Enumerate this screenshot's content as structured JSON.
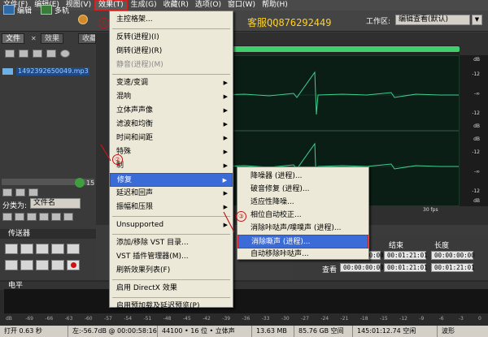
{
  "menubar": {
    "items": [
      "文件(F)",
      "编辑(E)",
      "视图(V)",
      "效果(T)",
      "生成(G)",
      "收藏(R)",
      "选项(O)",
      "窗口(W)",
      "帮助(H)"
    ],
    "active_index": 3
  },
  "toolbar": {
    "edit_label": "编辑",
    "multitrack_label": "多轨",
    "service_text": "客服QQ876292449",
    "workspace_label": "工作区:",
    "workspace_value": "编辑查看(默认)"
  },
  "left_panel": {
    "tabs": [
      "文件",
      "效果",
      "收藏"
    ],
    "selected_tab": 0,
    "file_name": "1492392650049.mp3",
    "sort_label": "分类为:",
    "sort_value": "文件名",
    "count": "15",
    "transport_label": "传送器"
  },
  "effects_menu": {
    "items": [
      {
        "label": "主控格架...",
        "disabled": false,
        "submenu": false
      },
      {
        "label": "反转(进程)(I)",
        "disabled": false,
        "submenu": false
      },
      {
        "label": "倒转(进程)(R)",
        "disabled": false,
        "submenu": false
      },
      {
        "label": "静音(进程)(M)",
        "disabled": true,
        "submenu": false
      },
      {
        "label": "变速/变调",
        "disabled": false,
        "submenu": true
      },
      {
        "label": "混响",
        "disabled": false,
        "submenu": true
      },
      {
        "label": "立体声声像",
        "disabled": false,
        "submenu": true
      },
      {
        "label": "滤波和均衡",
        "disabled": false,
        "submenu": true
      },
      {
        "label": "时间和间距",
        "disabled": false,
        "submenu": true
      },
      {
        "label": "特殊",
        "disabled": false,
        "submenu": true
      },
      {
        "label": "制",
        "disabled": false,
        "submenu": true
      },
      {
        "label": "修复",
        "disabled": false,
        "submenu": true
      },
      {
        "label": "延迟和回声",
        "disabled": false,
        "submenu": true
      },
      {
        "label": "振幅和压限",
        "disabled": false,
        "submenu": true
      },
      {
        "label": "Unsupported",
        "disabled": false,
        "submenu": true
      },
      {
        "label": "添加/移除 VST 目录...",
        "disabled": false,
        "submenu": false
      },
      {
        "label": "VST 插件管理器(M)...",
        "disabled": false,
        "submenu": false
      },
      {
        "label": "刷新效果列表(F)",
        "disabled": false,
        "submenu": false
      },
      {
        "label": "启用 DirectX 效果",
        "disabled": false,
        "submenu": false
      },
      {
        "label": "启用预加载及延迟预览(P)",
        "disabled": false,
        "submenu": false
      }
    ],
    "highlighted_index": 11
  },
  "repair_submenu": {
    "items": [
      "降噪器 (进程)...",
      "破音修复 (进程)...",
      "适应性降噪...",
      "相位自动校正...",
      "消除咔哒声/噗噗声 (进程)...",
      "消除嘶声 (进程)...",
      "自动移除咔哒声..."
    ],
    "highlighted_index": 5
  },
  "annotations": {
    "step1": "①",
    "step2": "②",
    "step3": "③"
  },
  "db_scale": {
    "top": [
      "dB",
      "-12",
      "-∞",
      "-12",
      "dB"
    ],
    "bottom": [
      "dB",
      "-12",
      "-∞",
      "-12",
      "dB"
    ]
  },
  "time_ruler": {
    "end_label": "30 fps"
  },
  "info_panel": {
    "col_end": "结束",
    "col_length": "长度",
    "view_label": "查看",
    "start_value": "00:00:00:00",
    "end_value": "00:01:21:01",
    "length_value": "00:00:00:00",
    "view_start": "00:00:00:00",
    "view_end": "00:01:21:01",
    "view_length": "00:01:21:01"
  },
  "level_meter": {
    "label": "电平",
    "ticks": [
      "dB",
      "-69",
      "-66",
      "-63",
      "-60",
      "-57",
      "-54",
      "-51",
      "-48",
      "-45",
      "-42",
      "-39",
      "-36",
      "-33",
      "-30",
      "-27",
      "-24",
      "-21",
      "-18",
      "-15",
      "-12",
      "-9",
      "-6",
      "-3",
      "0"
    ]
  },
  "status_bar": {
    "open_time": "打开 0.63 秒",
    "left_info": "左:-56.7dB @ 00:00:58:16",
    "format": "44100 • 16 位 • 立体声",
    "file_size": "13.63 MB",
    "free_space": "85.76 GB 空间",
    "time_remaining": "145:01:12.74 空闲",
    "view_mode": "波形"
  },
  "colors": {
    "accent": "#3b6bd6",
    "highlight_border": "#d02020",
    "wave": "#3fcf8f",
    "service_text": "#ffd21f"
  }
}
